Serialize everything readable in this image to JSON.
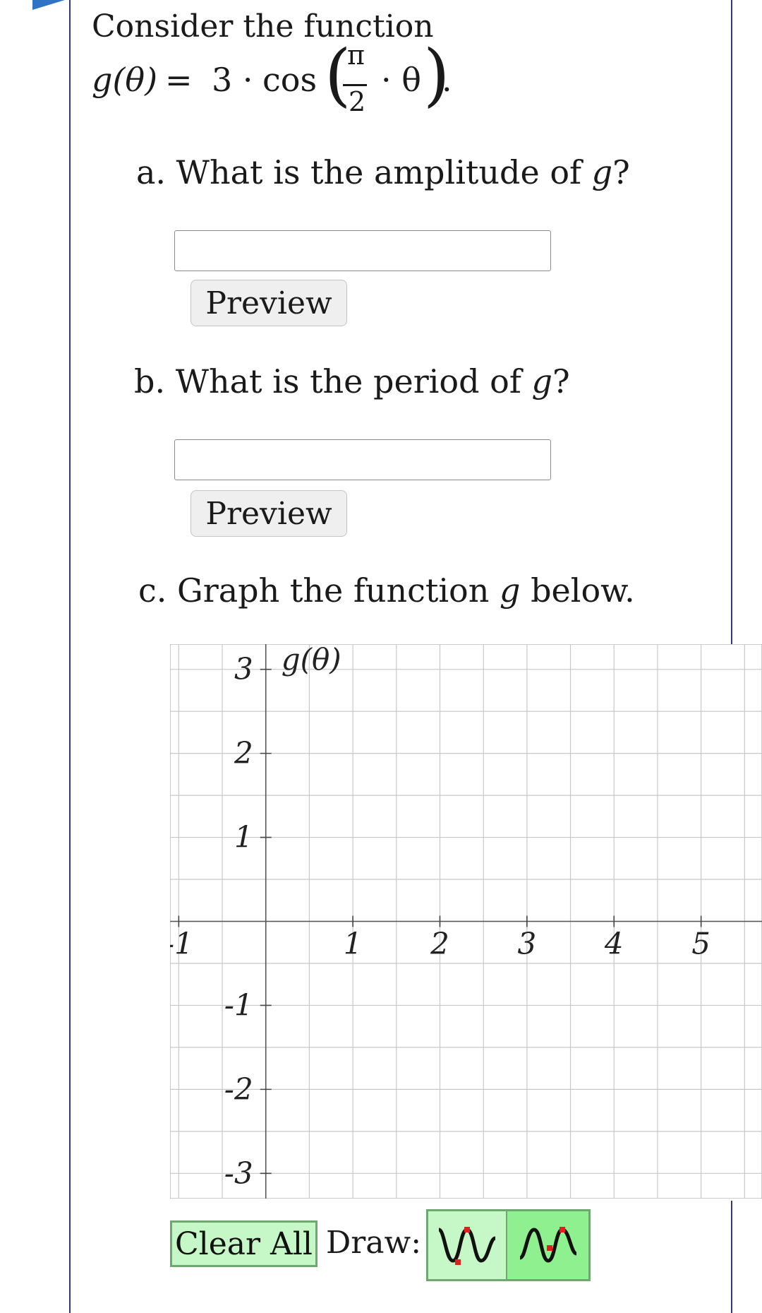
{
  "intro": "Consider the function",
  "formula": {
    "lhs": "g(θ)",
    "equals": "=",
    "coefficient": "3 ·",
    "func": "cos",
    "numerator": "π",
    "denominator": "2",
    "times_theta": "· θ",
    "period_mark": "."
  },
  "questions": {
    "a": {
      "text": "a. What is the amplitude of ",
      "var": "g",
      "end": "?",
      "input_value": "",
      "preview_label": "Preview"
    },
    "b": {
      "text": "b. What is the period of ",
      "var": "g",
      "end": "?",
      "input_value": "",
      "preview_label": "Preview"
    },
    "c": {
      "text": "c. Graph the function ",
      "var": "g",
      "end": " below."
    }
  },
  "graph": {
    "y_axis_label": "g(θ)",
    "x_ticks": [
      {
        "value": -1,
        "label": "-1"
      },
      {
        "value": 1,
        "label": "1"
      },
      {
        "value": 2,
        "label": "2"
      },
      {
        "value": 3,
        "label": "3"
      },
      {
        "value": 4,
        "label": "4"
      },
      {
        "value": 5,
        "label": "5"
      }
    ],
    "y_ticks": [
      {
        "value": 3,
        "label": "3"
      },
      {
        "value": 2,
        "label": "2"
      },
      {
        "value": 1,
        "label": "1"
      },
      {
        "value": -1,
        "label": "-1"
      },
      {
        "value": -2,
        "label": "-2"
      },
      {
        "value": -3,
        "label": "-3"
      }
    ],
    "x_range": [
      -1.1,
      5.7
    ],
    "y_range": [
      -3.3,
      3.3
    ],
    "grid_step": 0.5,
    "grid": true
  },
  "toolbar": {
    "clear_label": "Clear All",
    "draw_label": "Draw:",
    "tools": [
      "sine-wave-tool",
      "sine-wave-point-tool"
    ],
    "active_tool": "sine-wave-tool"
  },
  "colors": {
    "accent": "#2f73c4",
    "grid": "#c8c8c8",
    "tool_bg": "#8ff08f",
    "tool_active_bg": "#c6f7c6",
    "tool_border": "#6ea86e",
    "point_marker": "#e0201c"
  }
}
